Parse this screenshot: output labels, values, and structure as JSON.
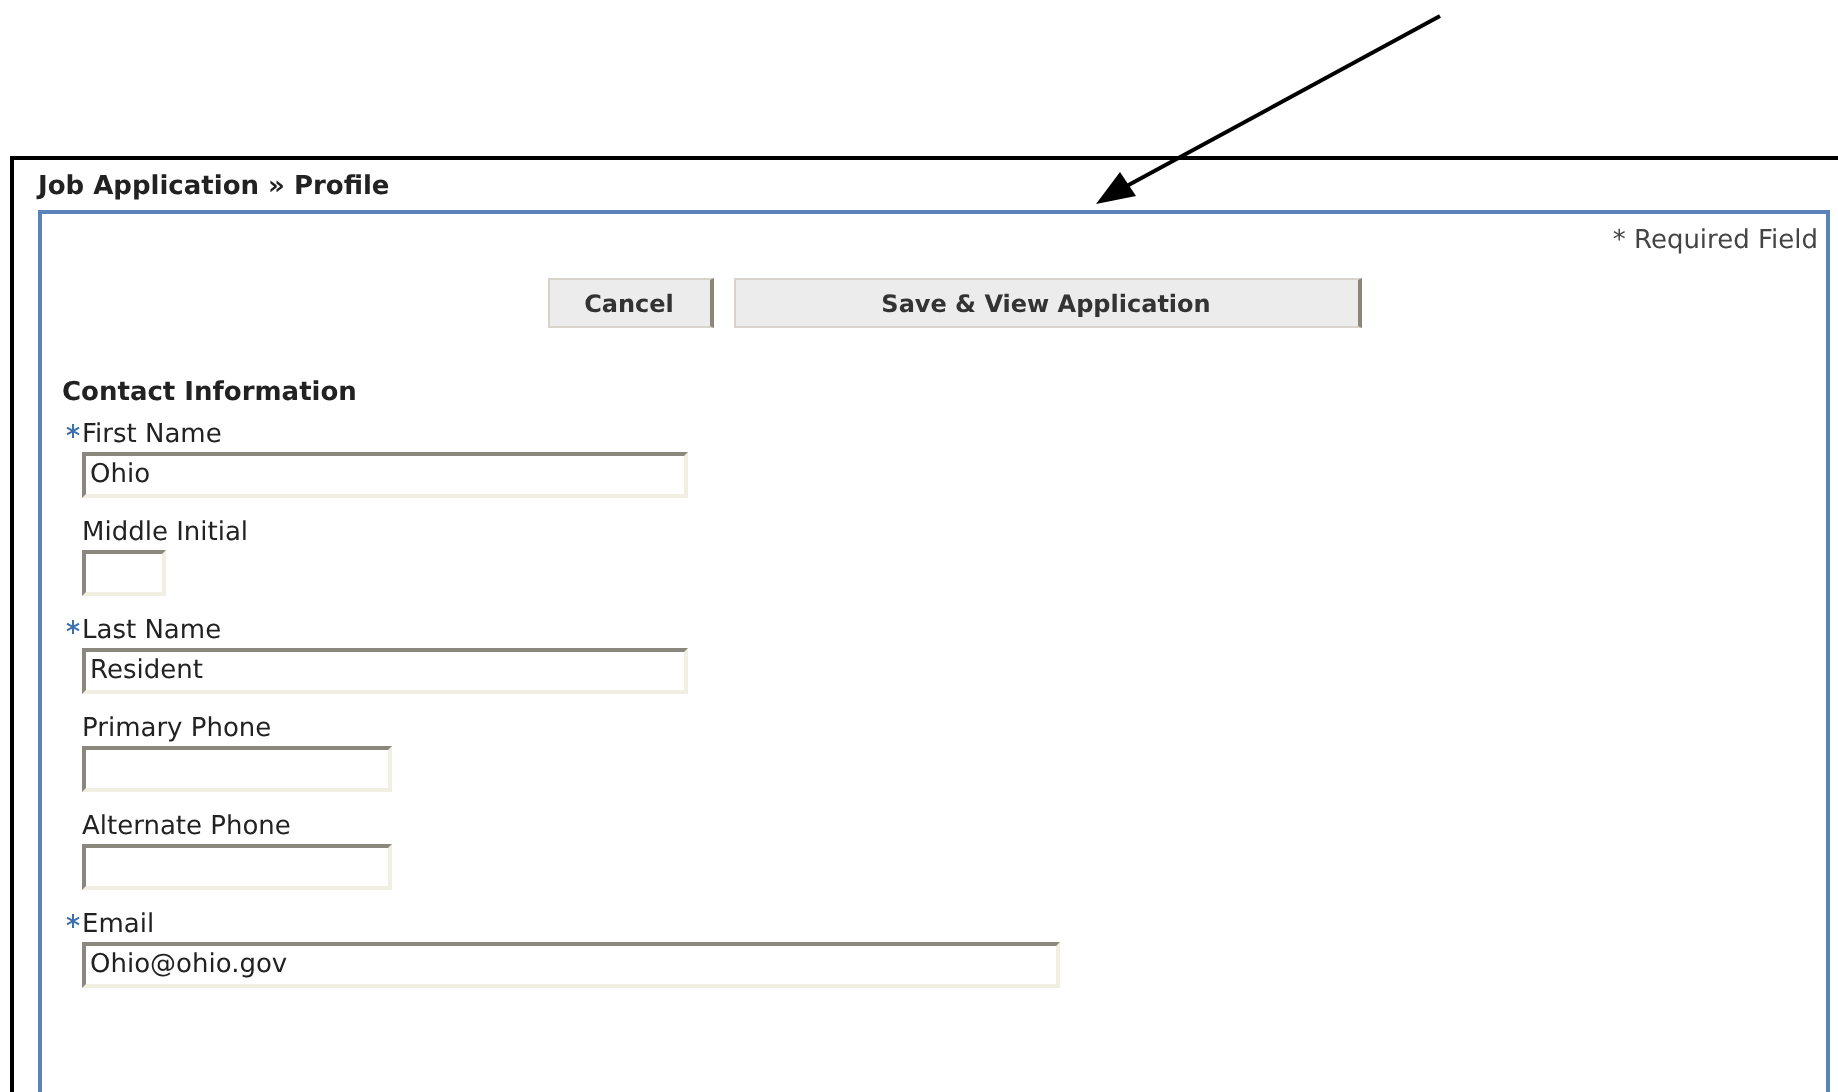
{
  "breadcrumb": "Job Application » Profile",
  "required_note": "* Required Field",
  "buttons": [
    {
      "kind": "cancel",
      "label": "Cancel"
    },
    {
      "kind": "save",
      "label": "Save & View Application"
    }
  ],
  "section": {
    "title": "Contact Information",
    "fields": [
      {
        "label": "First Name",
        "required": true,
        "kind": "name",
        "value": "Ohio"
      },
      {
        "label": "Middle Initial",
        "required": false,
        "kind": "initial"
      },
      {
        "label": "Last Name",
        "required": true,
        "kind": "name",
        "value": "Resident"
      },
      {
        "label": "Primary Phone",
        "required": false,
        "kind": "phone"
      },
      {
        "label": "Alternate Phone",
        "required": false,
        "kind": "phone"
      },
      {
        "label": "Email",
        "required": true,
        "kind": "email",
        "value": "Ohio@ohio.gov"
      }
    ]
  }
}
